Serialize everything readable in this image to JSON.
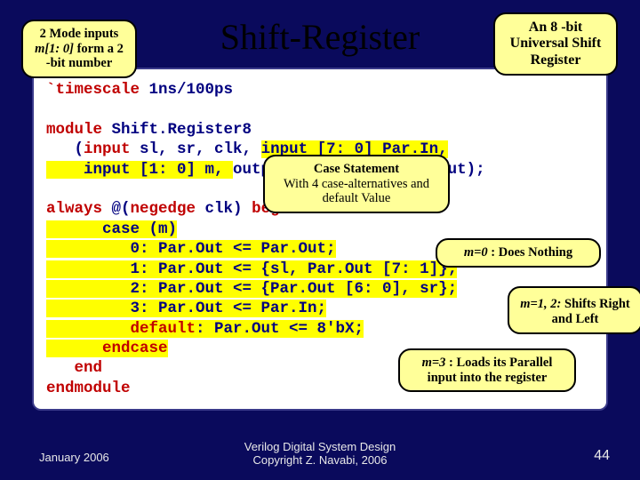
{
  "title": "Shift-Register",
  "code": {
    "l1a": "`timescale ",
    "l1b": "1ns/100ps",
    "l2": "",
    "l3a": "module ",
    "l3b": "Shift.Register8",
    "l4a": "   (",
    "l4b": "input ",
    "l4c": "sl, sr, clk,",
    "l4d": "input [7: 0] Par.In,",
    "l5a": "    input [1: 0] m, ",
    "l5b": "output reg [7: 0] Par.Out",
    "l5c": ");",
    "l6": "",
    "l7a": "always ",
    "l7b": "@(",
    "l7c": "negedge ",
    "l7d": "clk) ",
    "l7e": "begin",
    "l8a": "      case (m)",
    "l9": "         0: Par.Out <= Par.Out;",
    "l10": "         1: Par.Out <= {sl, Par.Out [7: 1]};",
    "l11": "         2: Par.Out <= {Par.Out [6: 0], sr};",
    "l12": "         3: Par.Out <= Par.In;",
    "l13a": "         default",
    "l13b": ": Par.Out <= 8'bX;",
    "l14": "      endcase",
    "l15": "   end",
    "l16": "endmodule"
  },
  "callouts": {
    "c1a": "2 Mode inputs ",
    "c1b": "m[1: 0]",
    "c1c": " form a 2 -bit number",
    "c2": "An 8 -bit Universal Shift Register",
    "c3a": "Case Statement",
    "c3b": "With 4 case-alternatives and default Value",
    "c4a": "m=0",
    "c4b": " : Does Nothing",
    "c5a": "m=1, 2:",
    "c5b": " Shifts Right and Left",
    "c6a": "m=3",
    "c6b": " : Loads its Parallel input into the register"
  },
  "footer": {
    "left": "January 2006",
    "center1": "Verilog Digital System Design",
    "center2": "Copyright Z. Navabi, 2006",
    "right": "44"
  }
}
